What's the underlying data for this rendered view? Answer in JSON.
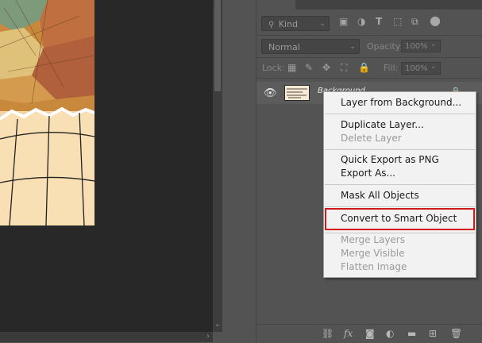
{
  "layers_panel": {
    "filter": {
      "kind_label": "Kind",
      "icons": [
        "image-filter-icon",
        "adjustment-filter-icon",
        "type-filter-icon",
        "shape-filter-icon",
        "smart-object-filter-icon",
        "toggle-filter-icon"
      ]
    },
    "blend_mode": "Normal",
    "opacity_label": "Opacity:",
    "opacity_value": "100%",
    "lock_label": "Lock:",
    "fill_label": "Fill:",
    "fill_value": "100%",
    "layers": [
      {
        "name": "Background",
        "visible": true,
        "locked": true
      }
    ],
    "bottom_icons": [
      "link-icon",
      "fx-icon",
      "mask-icon",
      "adjustment-icon",
      "group-icon",
      "new-layer-icon",
      "trash-icon"
    ],
    "bottom_fx": "fx"
  },
  "context_menu": {
    "items": [
      {
        "label": "Layer from Background...",
        "enabled": true
      },
      {
        "label": "Duplicate Layer...",
        "enabled": true
      },
      {
        "label": "Delete Layer",
        "enabled": false
      },
      {
        "label": "Quick Export as PNG",
        "enabled": true
      },
      {
        "label": "Export As...",
        "enabled": true
      },
      {
        "label": "Mask All Objects",
        "enabled": true
      },
      {
        "label": "Convert to Smart Object",
        "enabled": true,
        "highlighted": true
      },
      {
        "label": "Merge Layers",
        "enabled": false
      },
      {
        "label": "Merge Visible",
        "enabled": false
      },
      {
        "label": "Flatten Image",
        "enabled": false
      }
    ],
    "highlight_color": "#d11b1b"
  },
  "colors": {
    "panel": "#535353",
    "canvas": "#282828",
    "menu_bg": "#f2f2f2"
  }
}
